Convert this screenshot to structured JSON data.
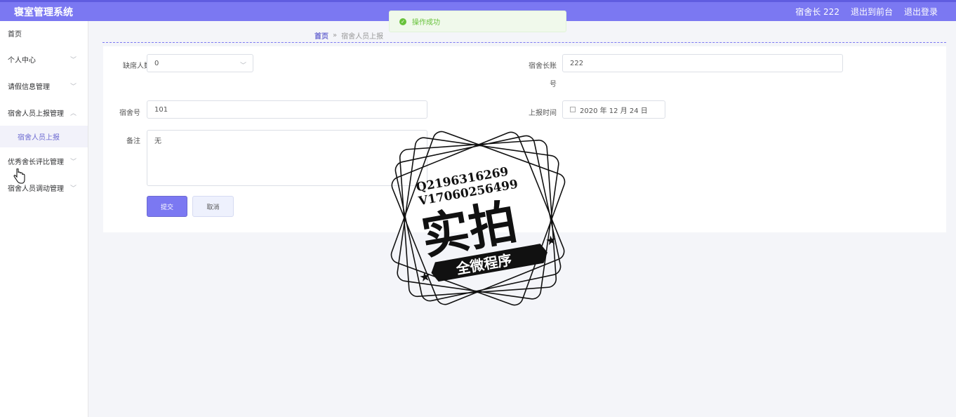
{
  "header": {
    "app_title": "寝室管理系统",
    "user": "宿舍长 222",
    "exit_front": "退出到前台",
    "logout": "退出登录"
  },
  "toast": {
    "message": "操作成功",
    "icon": "check-circle-icon"
  },
  "sidebar": {
    "items": [
      {
        "label": "首页"
      },
      {
        "label": "个人中心"
      },
      {
        "label": "请假信息管理"
      },
      {
        "label": "宿舍人员上报管理"
      },
      {
        "label": "宿舍人员上报"
      },
      {
        "label": "优秀舍长评比管理"
      },
      {
        "label": "宿舍人员调动管理"
      }
    ]
  },
  "breadcrumb": {
    "home": "首页",
    "separator": "»",
    "current": "宿舍人员上报"
  },
  "form": {
    "absent": {
      "label": "缺席人数",
      "value": "0"
    },
    "leader_account": {
      "label_line1": "宿舍长账",
      "label_line2": "号",
      "value": "222"
    },
    "dorm_no": {
      "label": "宿舍号",
      "value": "101"
    },
    "report_time": {
      "label": "上报时间",
      "value": "2020 年 12 月 24 日"
    },
    "remark": {
      "label": "备注",
      "value": "无"
    },
    "submit": "提交",
    "cancel": "取消"
  },
  "watermark": {
    "line1": "Q2196316269",
    "line2": "V17060256499",
    "big": "实拍",
    "ribbon": "全微程序"
  },
  "colors": {
    "accent": "#7b78f2",
    "success": "#67c23a"
  }
}
